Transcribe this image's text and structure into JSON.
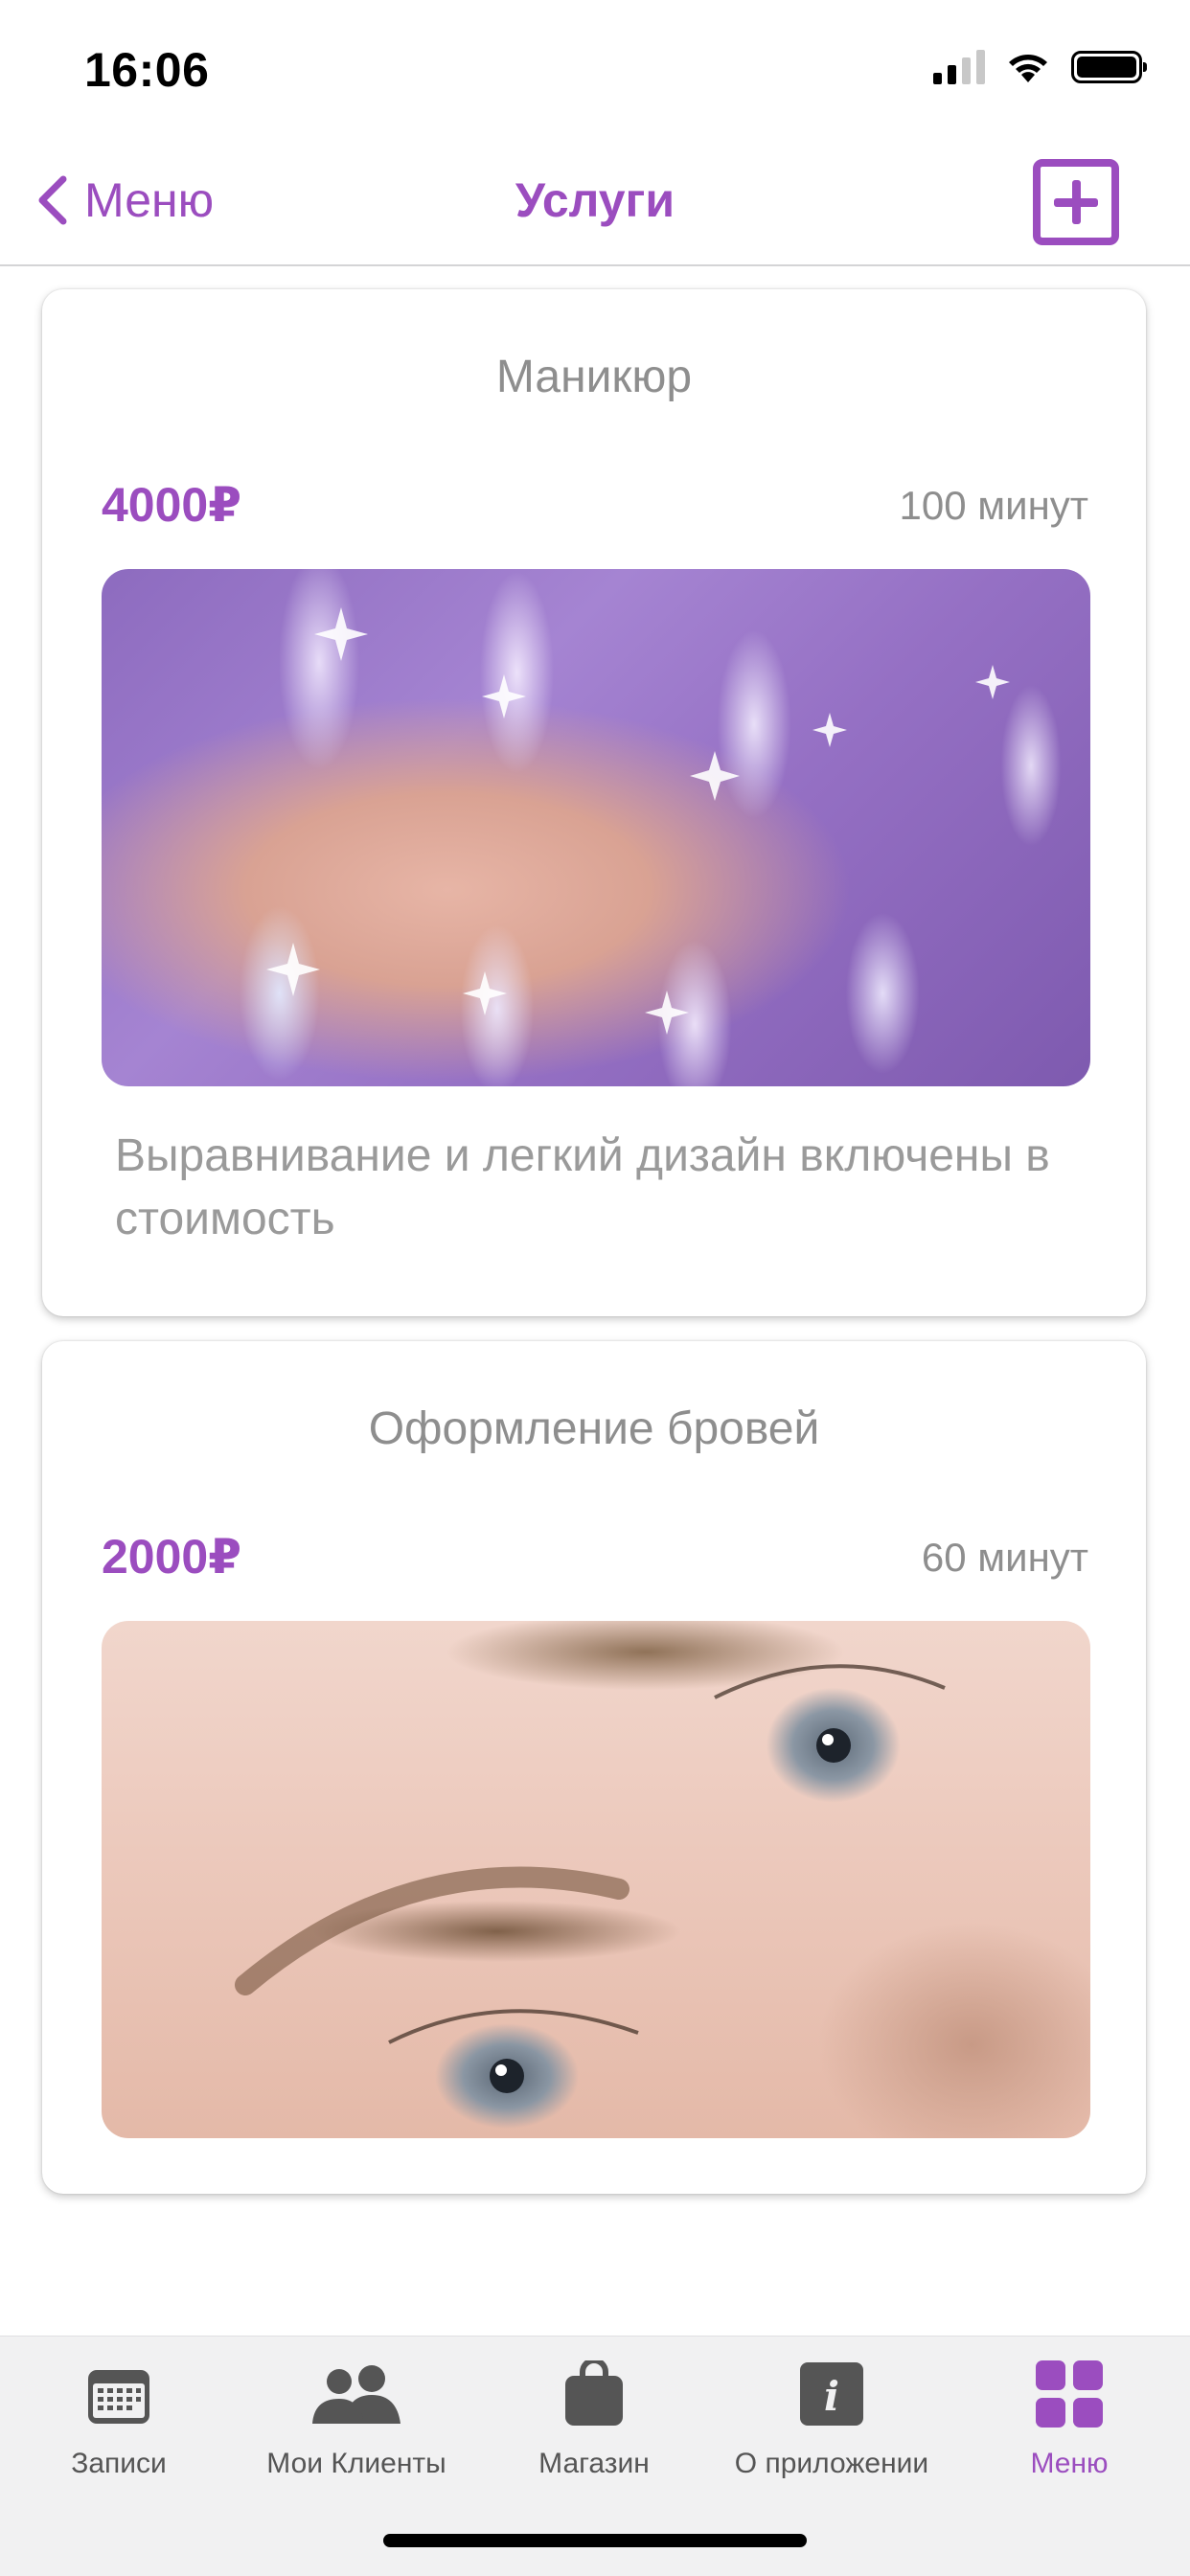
{
  "status_bar": {
    "time": "16:06",
    "signal_bars": 2,
    "battery_level": 1.0
  },
  "nav": {
    "back_label": "Меню",
    "title": "Услуги",
    "add_icon": "plus-square-icon"
  },
  "services": [
    {
      "title": "Маникюр",
      "price": "4000₽",
      "duration": "100 минут",
      "photo_icon": "nails-photo",
      "description": "Выравнивание и легкий дизайн включены в стоимость"
    },
    {
      "title": "Оформление бровей",
      "price": "2000₽",
      "duration": "60 минут",
      "photo_icon": "eyebrows-photo"
    }
  ],
  "tab_bar": {
    "items": [
      {
        "label": "Записи",
        "icon": "calendar-icon"
      },
      {
        "label": "Мои Клиенты",
        "icon": "people-icon"
      },
      {
        "label": "Магазин",
        "icon": "bag-icon"
      },
      {
        "label": "О приложении",
        "icon": "info-icon"
      },
      {
        "label": "Меню",
        "icon": "grid-icon"
      }
    ],
    "active_index": 4
  },
  "colors": {
    "accent": "#9b4dbf",
    "muted_text": "#8e8e8e",
    "tab_icon": "#555555",
    "tab_bar_bg": "#f1f1f2"
  }
}
